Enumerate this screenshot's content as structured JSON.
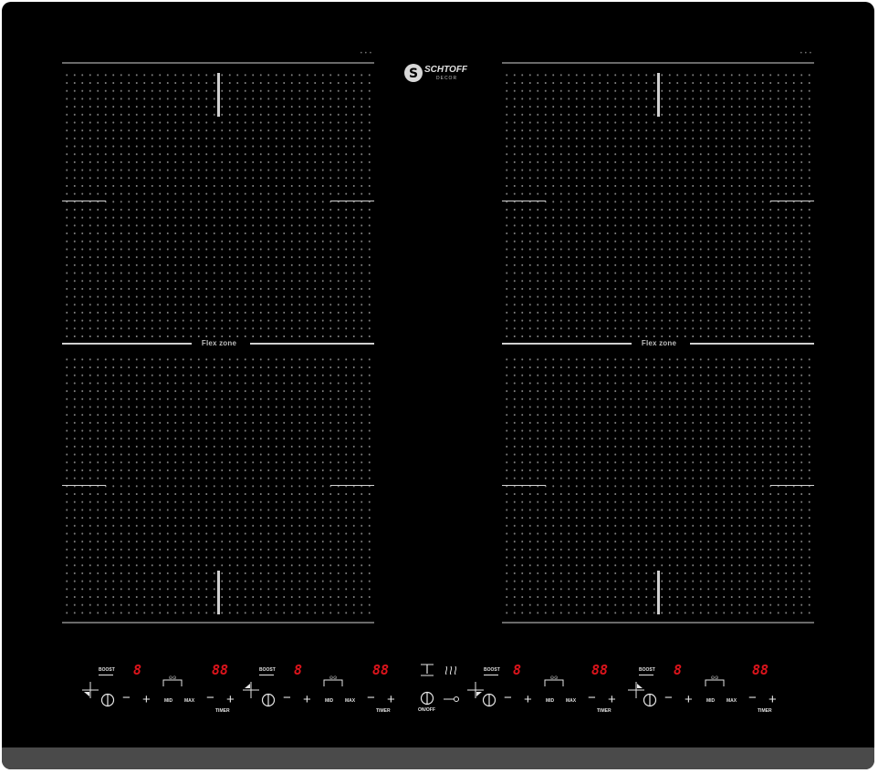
{
  "brand": {
    "name": "SCHTOFF",
    "sub": "DECOR"
  },
  "zones": {
    "left_flex_label": "Flex zone",
    "right_flex_label": "Flex zone"
  },
  "controls": [
    {
      "boost": "BOOST",
      "power": "8",
      "timer_digits": "88",
      "mid": "MID",
      "max": "MAX",
      "timer": "TIMER",
      "minus": "−",
      "plus": "+"
    },
    {
      "boost": "BOOST",
      "power": "8",
      "timer_digits": "88",
      "mid": "MID",
      "max": "MAX",
      "timer": "TIMER",
      "minus": "−",
      "plus": "+"
    },
    {
      "boost": "BOOST",
      "power": "8",
      "timer_digits": "88",
      "mid": "MID",
      "max": "MAX",
      "timer": "TIMER",
      "minus": "−",
      "plus": "+"
    },
    {
      "boost": "BOOST",
      "power": "8",
      "timer_digits": "88",
      "mid": "MID",
      "max": "MAX",
      "timer": "TIMER",
      "minus": "−",
      "plus": "+"
    }
  ],
  "center_controls": {
    "onoff": "ON/OFF"
  },
  "colors": {
    "panel": "#000000",
    "display": "#e0141c",
    "strip": "#4a4a4a"
  },
  "icons": [
    "power-icon",
    "pause-icon",
    "keep-warm-icon",
    "lock-icon",
    "zone-indicator-icon",
    "bridge-icon"
  ]
}
